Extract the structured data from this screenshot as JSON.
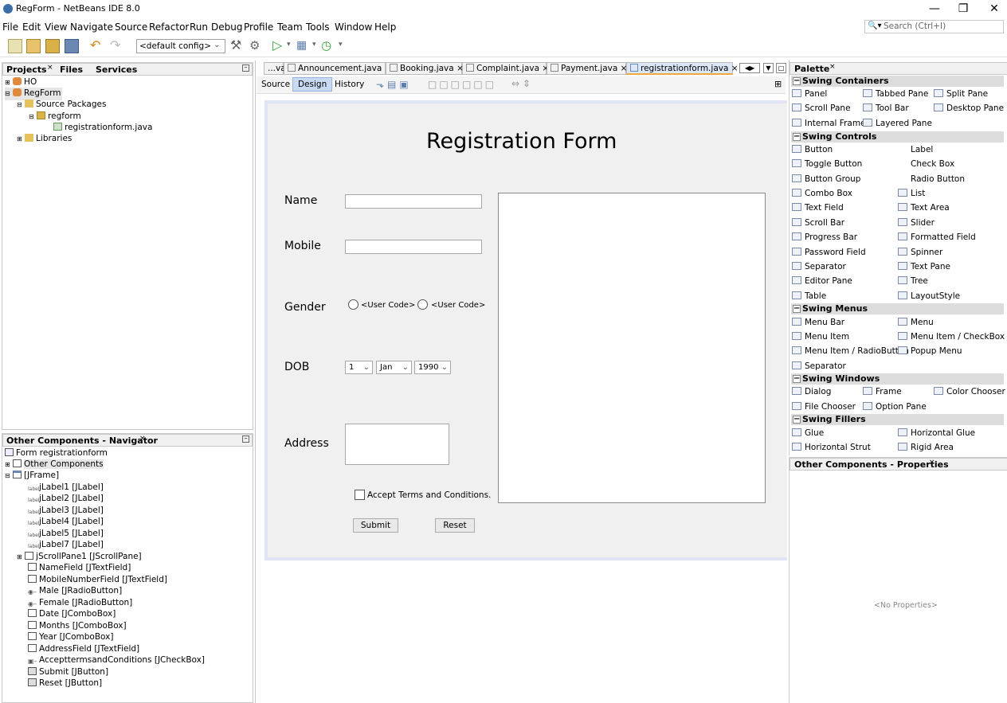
{
  "window": {
    "title": "RegForm - NetBeans IDE 8.0",
    "minimize": "—",
    "maximize": "❐",
    "close": "✕"
  },
  "menubar": [
    "File",
    "Edit",
    "View",
    "Navigate",
    "Source",
    "Refactor",
    "Run",
    "Debug",
    "Profile",
    "Team",
    "Tools",
    "Window",
    "Help"
  ],
  "search": {
    "placeholder": "Search (Ctrl+I)"
  },
  "toolbar": {
    "config": "<default config>"
  },
  "projects_panel": {
    "tabs": [
      "Projects",
      "Files",
      "Services"
    ],
    "tree": [
      {
        "label": "HO",
        "icon": "project-icon"
      },
      {
        "label": "RegForm",
        "icon": "project-icon"
      },
      {
        "label": "Source Packages",
        "icon": "folder-icon"
      },
      {
        "label": "regform",
        "icon": "package-icon"
      },
      {
        "label": "registrationform.java",
        "icon": "java-form-icon"
      },
      {
        "label": "Libraries",
        "icon": "library-icon"
      }
    ]
  },
  "navigator": {
    "title": "Other Components - Navigator",
    "items": [
      "Form registrationform",
      "Other Components",
      "[JFrame]",
      "jLabel1 [JLabel]",
      "jLabel2 [JLabel]",
      "jLabel3 [JLabel]",
      "jLabel4 [JLabel]",
      "jLabel5 [JLabel]",
      "jLabel7 [JLabel]",
      "jScrollPane1 [JScrollPane]",
      "NameField [JTextField]",
      "MobileNumberField [JTextField]",
      "Male [JRadioButton]",
      "Female [JRadioButton]",
      "Date [JComboBox]",
      "Months [JComboBox]",
      "Year [JComboBox]",
      "AddressField [JTextField]",
      "AccepttermsandConditions [JCheckBox]",
      "Submit [JButton]",
      "Reset [JButton]"
    ]
  },
  "editor": {
    "tabs": [
      "...va",
      "Announcement.java",
      "Booking.java",
      "Complaint.java",
      "Payment.java",
      "registrationform.java"
    ],
    "subtabs": [
      "Source",
      "Design",
      "History"
    ],
    "form": {
      "title": "Registration Form",
      "name_label": "Name",
      "mobile_label": "Mobile",
      "gender_label": "Gender",
      "radio1": "<User Code>",
      "radio2": "<User Code>",
      "dob_label": "DOB",
      "day": "1",
      "month": "Jan",
      "year": "1990",
      "address_label": "Address",
      "terms": "Accept Terms and Conditions.",
      "submit": "Submit",
      "reset": "Reset"
    }
  },
  "palette": {
    "title": "Palette",
    "sections": {
      "containers": "Swing Containers",
      "controls": "Swing Controls",
      "menus": "Swing Menus",
      "windows": "Swing Windows",
      "fillers": "Swing Fillers"
    },
    "containers": [
      "Panel",
      "Tabbed Pane",
      "Split Pane",
      "Scroll Pane",
      "Tool Bar",
      "Desktop Pane",
      "Internal Frame",
      "Layered Pane"
    ],
    "controls": [
      "Button",
      "Label",
      "Toggle Button",
      "Check Box",
      "Button Group",
      "Radio Button",
      "Combo Box",
      "List",
      "Text Field",
      "Text Area",
      "Scroll Bar",
      "Slider",
      "Progress Bar",
      "Formatted Field",
      "Password Field",
      "Spinner",
      "Separator",
      "Text Pane",
      "Editor Pane",
      "Tree",
      "Table",
      "LayoutStyle"
    ],
    "menus": [
      "Menu Bar",
      "Menu",
      "Menu Item",
      "Menu Item / CheckBox",
      "Menu Item / RadioButton",
      "Popup Menu",
      "Separator"
    ],
    "windows": [
      "Dialog",
      "Frame",
      "Color Chooser",
      "File Chooser",
      "Option Pane"
    ],
    "fillers": [
      "Glue",
      "Horizontal Glue",
      "Horizontal Strut",
      "Rigid Area"
    ]
  },
  "properties": {
    "title": "Other Components - Properties",
    "empty": "<No Properties>"
  },
  "colors": {
    "accent": "#d7e3f4",
    "canvas_border": "#e1e4f5",
    "selected_tab": "#dbe6f7"
  }
}
